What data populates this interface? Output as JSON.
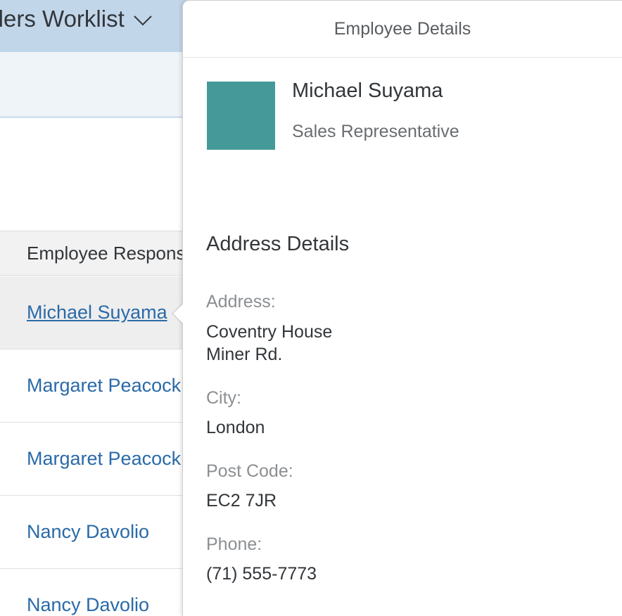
{
  "app": {
    "title": "Orders Worklist"
  },
  "table": {
    "column_header": "Employee Responsible",
    "rows": [
      {
        "employee": "Michael Suyama"
      },
      {
        "employee": "Margaret Peacock"
      },
      {
        "employee": "Margaret Peacock"
      },
      {
        "employee": "Nancy Davolio"
      },
      {
        "employee": "Nancy Davolio"
      }
    ]
  },
  "popover": {
    "title": "Employee Details",
    "name": "Michael Suyama",
    "role": "Sales Representative",
    "avatar_color": "#459999",
    "section_title": "Address Details",
    "address_label": "Address:",
    "address_line1": "Coventry House",
    "address_line2": "Miner Rd.",
    "city_label": "City:",
    "city": "London",
    "postcode_label": "Post Code:",
    "postcode": "EC2 7JR",
    "phone_label": "Phone:",
    "phone": "(71) 555-7773"
  },
  "colors": {
    "shell_header": "#c2d6ea",
    "link": "#2a6aa8",
    "text": "#32363a"
  }
}
